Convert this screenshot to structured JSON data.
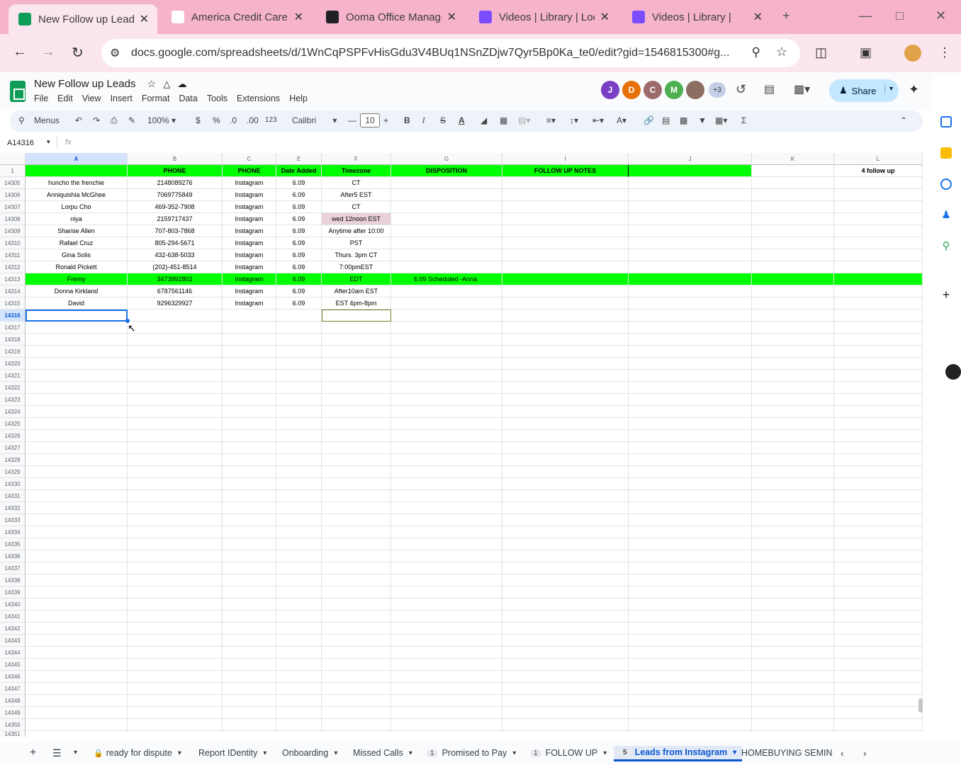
{
  "browser": {
    "tabs": [
      {
        "label": "New Follow up Leads",
        "fav_color": "#0f9d58"
      },
      {
        "label": "America Credit Care",
        "fav_color": "#ffffff"
      },
      {
        "label": "Ooma Office Manage",
        "fav_color": "#202124"
      },
      {
        "label": "Videos | Library | Loo",
        "fav_color": "#7c4dff"
      },
      {
        "label": "Videos | Library |",
        "fav_color": "#7c4dff"
      }
    ],
    "new_tab": "+",
    "url": "docs.google.com/spreadsheets/d/1WnCqPSPFvHisGdu3V4BUq1NSnZDjw7Qyr5Bp0Ka_te0/edit?gid=1546815300#g..."
  },
  "app": {
    "doc_title": "New Follow up Leads",
    "menus": [
      "File",
      "Edit",
      "View",
      "Insert",
      "Format",
      "Data",
      "Tools",
      "Extensions",
      "Help"
    ],
    "collaborators": [
      {
        "initial": "J",
        "color": "#7b3fc4"
      },
      {
        "initial": "D",
        "color": "#e8710a"
      },
      {
        "initial": "C",
        "color": "#9e6b6b"
      },
      {
        "initial": "M",
        "color": "#4caf50"
      },
      {
        "initial": "",
        "color": "#8d6e63"
      }
    ],
    "more_collaborators": "+3",
    "share_label": "Share"
  },
  "toolbar": {
    "menus_label": "Menus",
    "zoom": "100%",
    "currency": "$",
    "percent": "%",
    "dec_decrease": ".0",
    "dec_increase": ".00",
    "number_format": "123",
    "font": "Calibri",
    "font_size": "10",
    "bold": "B",
    "italic": "I",
    "strike": "S",
    "text_color": "A"
  },
  "formula": {
    "cell_ref": "A14316",
    "fx": "fx",
    "value": ""
  },
  "columns": [
    "A",
    "B",
    "C",
    "E",
    "F",
    "G",
    "I",
    "J",
    "K",
    "L"
  ],
  "header_row": {
    "num": "1",
    "cells": [
      "",
      "PHONE",
      "PHONE",
      "Date Added",
      "Timezone",
      "DISPOSITION",
      "FOLLOW UP NOTES",
      "",
      "",
      "4 follow up"
    ]
  },
  "rows": [
    {
      "num": "14305",
      "cells": [
        "huncho the frenchie",
        "2148089276",
        "Instagram",
        "6.09",
        "CT",
        "",
        "",
        "",
        "",
        ""
      ]
    },
    {
      "num": "14306",
      "cells": [
        "Anniquishia McGhee",
        "7069775849",
        "Instagram",
        "6.09",
        "After5 EST",
        "",
        "",
        "",
        "",
        ""
      ]
    },
    {
      "num": "14307",
      "cells": [
        "Lorpu Cho",
        "469-352-7908",
        "Instagram",
        "6.09",
        "CT",
        "",
        "",
        "",
        "",
        ""
      ]
    },
    {
      "num": "14308",
      "cells": [
        "niya",
        "2159717437",
        "Instagram",
        "6.09",
        "wed 12noon EST",
        "",
        "",
        "",
        "",
        ""
      ]
    },
    {
      "num": "14309",
      "cells": [
        "Sharise Allen",
        "707-803-7868",
        "Instagram",
        "6.09",
        "Anytime after 10:00",
        "",
        "",
        "",
        "",
        ""
      ]
    },
    {
      "num": "14310",
      "cells": [
        "Rafael Cruz",
        "805-294-5671",
        "Instagram",
        "6.09",
        "PST",
        "",
        "",
        "",
        "",
        ""
      ]
    },
    {
      "num": "14311",
      "cells": [
        "Gina Solis",
        "432-638-5033",
        "Instagram",
        "6.09",
        "Thurs. 3pm CT",
        "",
        "",
        "",
        "",
        ""
      ]
    },
    {
      "num": "14312",
      "cells": [
        "Ronald Pickett",
        "(202)-451-8514",
        "Instagram",
        "6.09",
        "7:00pmEST",
        "",
        "",
        "",
        "",
        ""
      ]
    },
    {
      "num": "14313",
      "cells": [
        "Fremy",
        "3473992802",
        "Instagram",
        "6.09",
        "EDT",
        "6.09 Scheduled -Anna",
        "",
        "",
        "",
        ""
      ]
    },
    {
      "num": "14314",
      "cells": [
        "Donna Kirkland",
        "6787561146",
        "Instagram",
        "6.09",
        "After10am EST",
        "",
        "",
        "",
        "",
        ""
      ]
    },
    {
      "num": "14315",
      "cells": [
        "David",
        "9296329927",
        "Instagram",
        "6.09",
        "EST 4pm-8pm",
        "",
        "",
        "",
        "",
        ""
      ]
    }
  ],
  "empty_row_start": 14316,
  "empty_row_end": 14350,
  "last_partial_row": "14351",
  "highlight": {
    "green": "#00ff00",
    "pink": "#ead1dc",
    "selected_row": "14316"
  },
  "sheets": [
    {
      "label": "ready for dispute",
      "badge": "",
      "lock": true
    },
    {
      "label": "Report IDentity",
      "badge": ""
    },
    {
      "label": "Onboarding",
      "badge": ""
    },
    {
      "label": "Missed Calls",
      "badge": ""
    },
    {
      "label": "Promised to Pay",
      "badge": "1"
    },
    {
      "label": "FOLLOW UP",
      "badge": "1"
    },
    {
      "label": "Leads from Instagram",
      "badge": "5",
      "active": true
    },
    {
      "label": "HOMEBUYING SEMINAR",
      "badge": ""
    }
  ]
}
